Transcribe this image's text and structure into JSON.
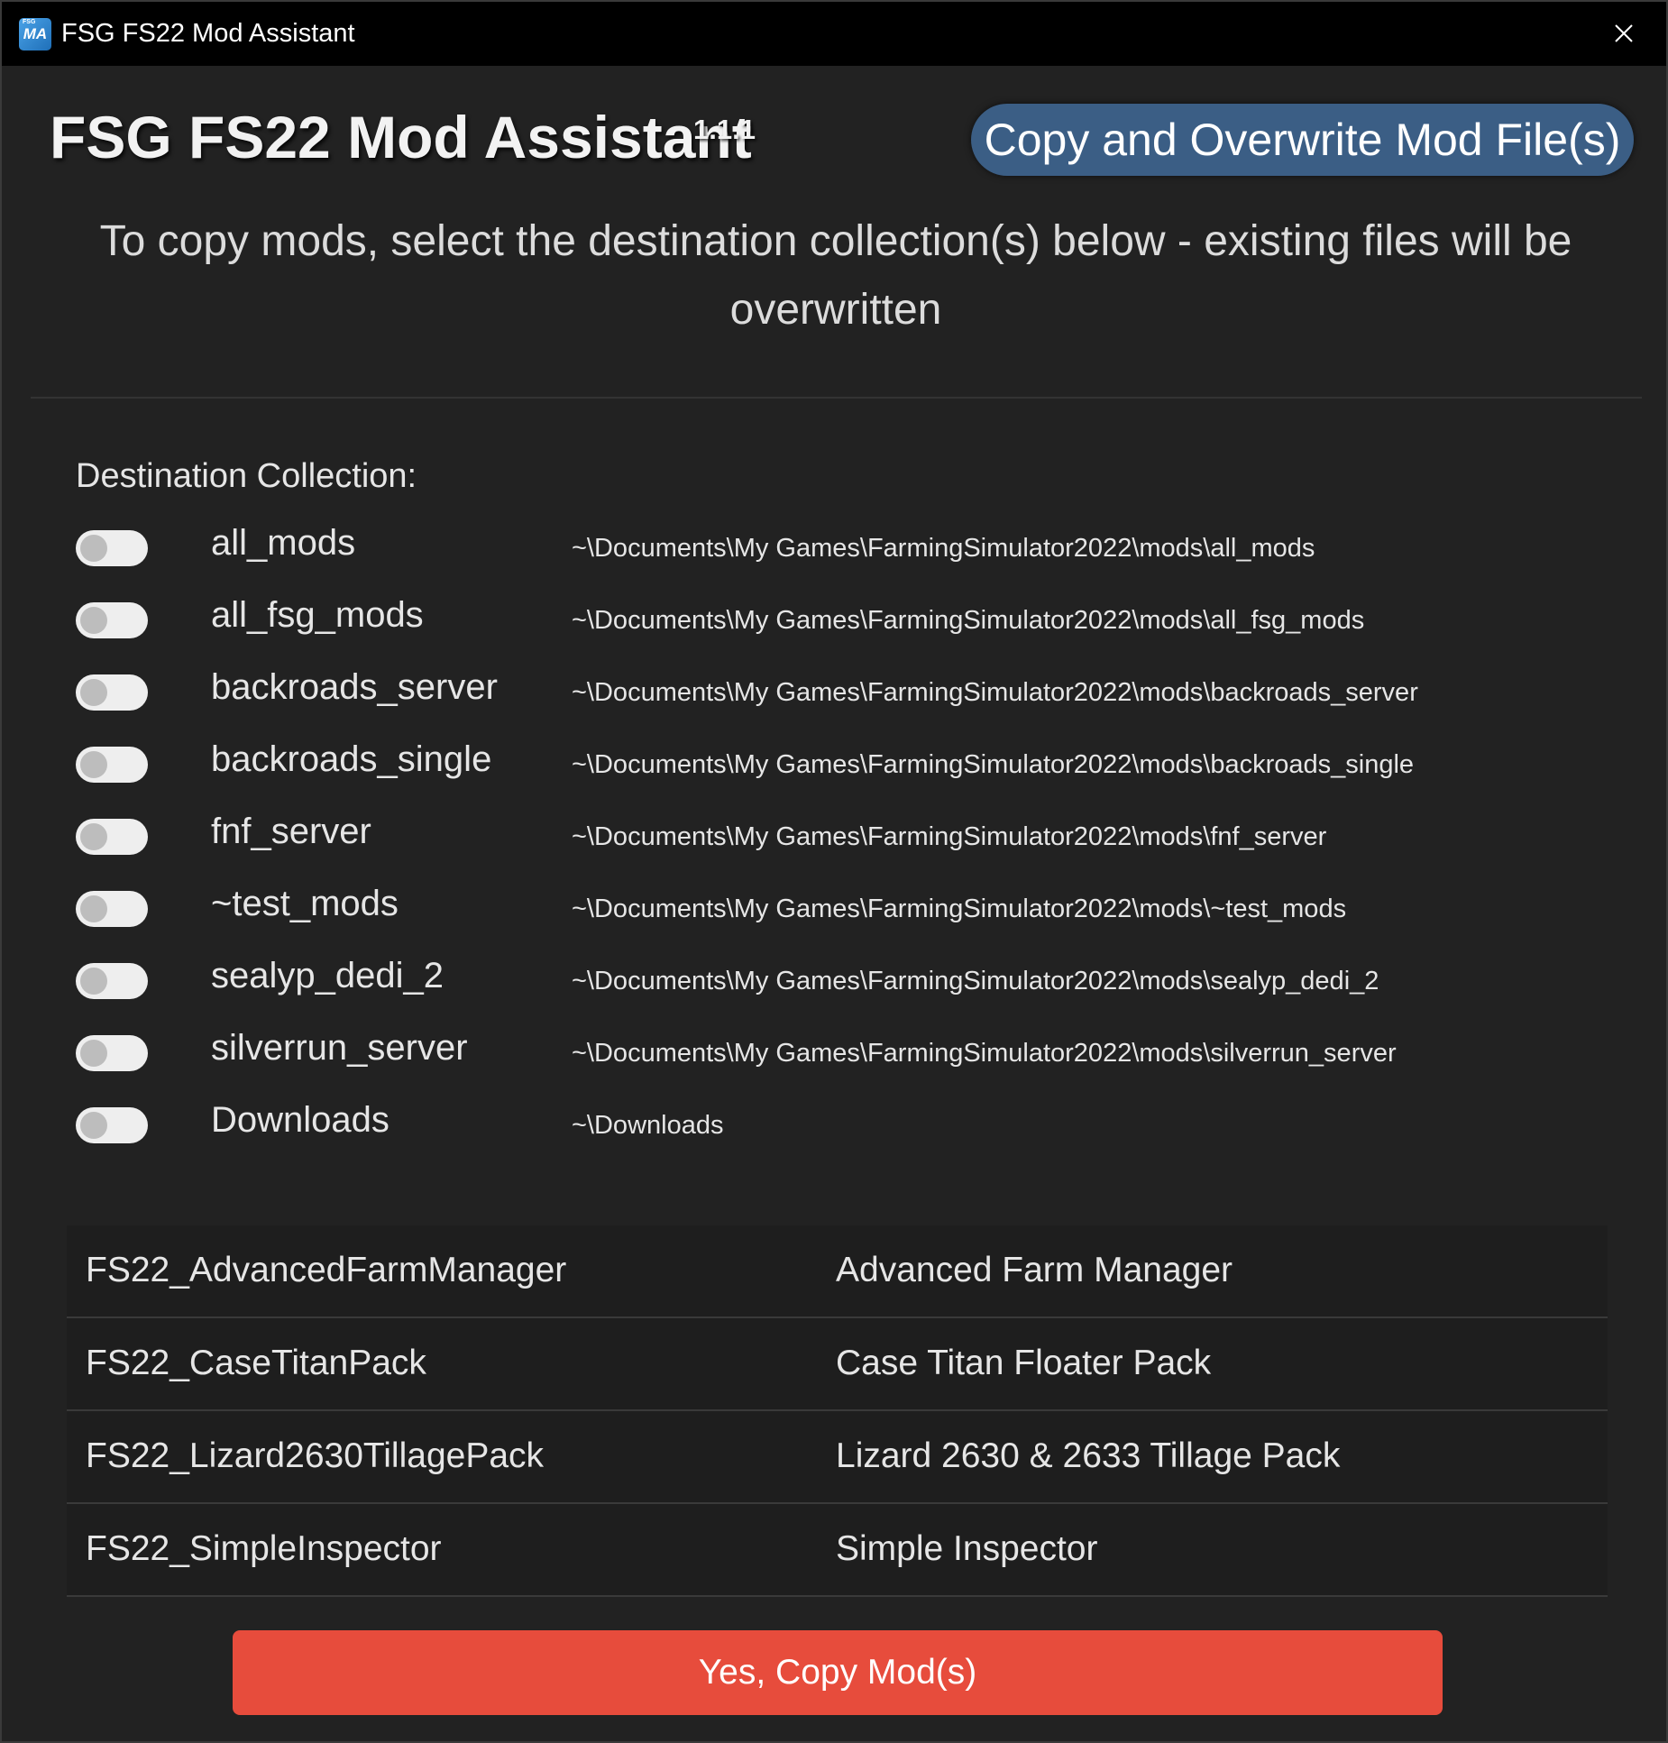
{
  "window": {
    "title": "FSG FS22 Mod Assistant",
    "icon_text": "MA",
    "icon_small_text": "FSG",
    "close_icon": "close-icon"
  },
  "header": {
    "app_title": "FSG FS22 Mod Assistant",
    "version": "1.1.1",
    "action_label": "Copy and Overwrite Mod File(s)",
    "instructions": "To copy mods, select the destination collection(s) below - existing files will be overwritten"
  },
  "destination": {
    "label": "Destination Collection:",
    "collections": [
      {
        "name": "all_mods",
        "path": "~\\Documents\\My Games\\FarmingSimulator2022\\mods\\all_mods",
        "selected": false
      },
      {
        "name": "all_fsg_mods",
        "path": "~\\Documents\\My Games\\FarmingSimulator2022\\mods\\all_fsg_mods",
        "selected": false
      },
      {
        "name": "backroads_server",
        "path": "~\\Documents\\My Games\\FarmingSimulator2022\\mods\\backroads_server",
        "selected": false
      },
      {
        "name": "backroads_single",
        "path": "~\\Documents\\My Games\\FarmingSimulator2022\\mods\\backroads_single",
        "selected": false
      },
      {
        "name": "fnf_server",
        "path": "~\\Documents\\My Games\\FarmingSimulator2022\\mods\\fnf_server",
        "selected": false
      },
      {
        "name": "~test_mods",
        "path": "~\\Documents\\My Games\\FarmingSimulator2022\\mods\\~test_mods",
        "selected": false
      },
      {
        "name": "sealyp_dedi_2",
        "path": "~\\Documents\\My Games\\FarmingSimulator2022\\mods\\sealyp_dedi_2",
        "selected": false
      },
      {
        "name": "silverrun_server",
        "path": "~\\Documents\\My Games\\FarmingSimulator2022\\mods\\silverrun_server",
        "selected": false
      },
      {
        "name": "Downloads",
        "path": "~\\Downloads",
        "selected": false
      }
    ]
  },
  "mods": [
    {
      "file": "FS22_AdvancedFarmManager",
      "title": "Advanced Farm Manager"
    },
    {
      "file": "FS22_CaseTitanPack",
      "title": "Case Titan Floater Pack"
    },
    {
      "file": "FS22_Lizard2630TillagePack",
      "title": "Lizard 2630 & 2633 Tillage Pack"
    },
    {
      "file": "FS22_SimpleInspector",
      "title": "Simple Inspector"
    }
  ],
  "confirm": {
    "label": "Yes, Copy Mod(s)"
  },
  "colors": {
    "background": "#222222",
    "titlebar": "#000000",
    "action_button": "#3b5e85",
    "confirm_button": "#e74c3c",
    "toggle_off": "#eeeeee"
  }
}
